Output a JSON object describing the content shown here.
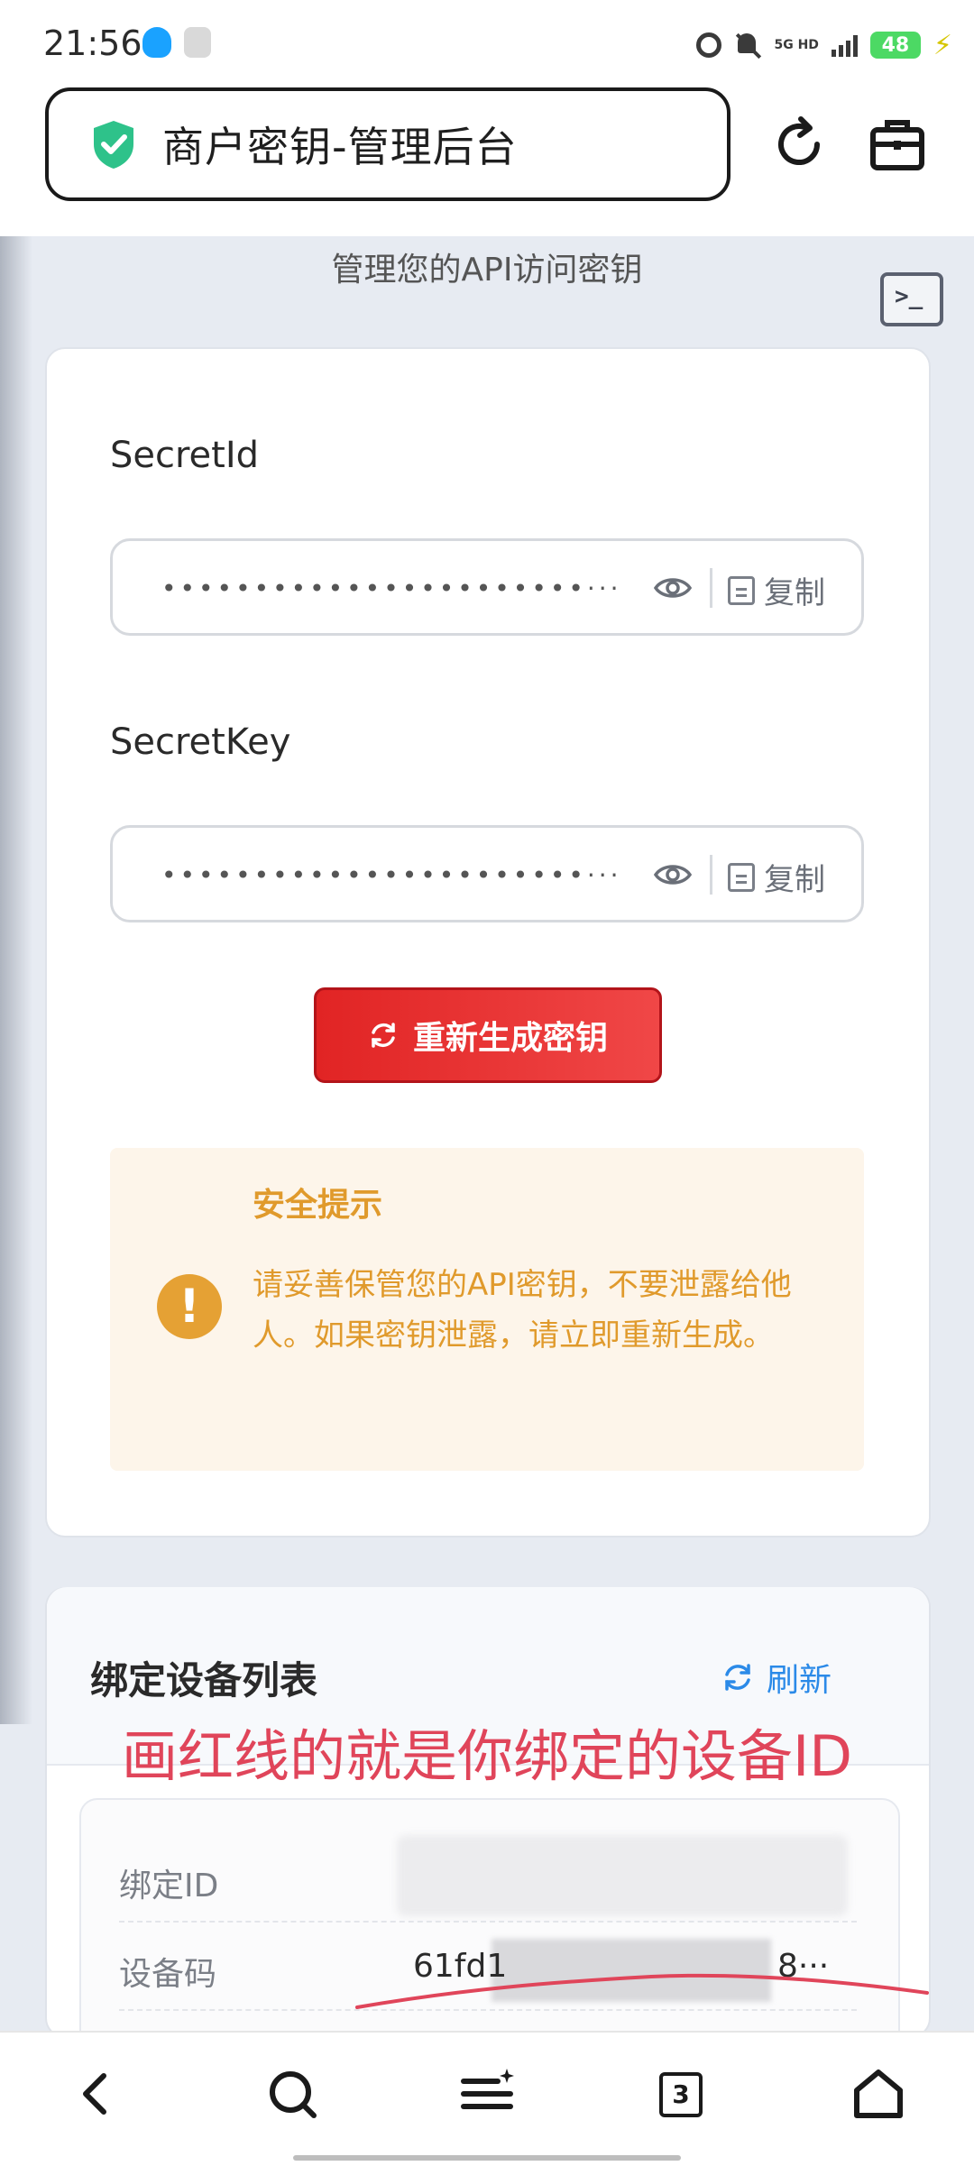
{
  "status_bar": {
    "time": "21:56",
    "network": "5G HD",
    "battery": "48"
  },
  "address_bar": {
    "title": "商户密钥-管理后台"
  },
  "page": {
    "subtitle": "管理您的API访问密钥",
    "secret_id": {
      "label": "SecretId",
      "value": "•••••••••••••••••••••••···",
      "copy_label": "复制"
    },
    "secret_key": {
      "label": "SecretKey",
      "value": "•••••••••••••••••••••••···",
      "copy_label": "复制"
    },
    "regenerate_label": "重新生成密钥",
    "warning": {
      "title": "安全提示",
      "text": "请妥善保管您的API密钥，不要泄露给他人。如果密钥泄露，请立即重新生成。"
    },
    "devices": {
      "title": "绑定设备列表",
      "refresh_label": "刷新",
      "annotation": "画红线的就是你绑定的设备ID",
      "rows": [
        {
          "label": "绑定ID",
          "value": ""
        },
        {
          "label": "设备码",
          "value_start": "61fd1",
          "value_end": "8···"
        }
      ]
    }
  },
  "bottom_bar": {
    "tab_count": "3"
  },
  "colors": {
    "danger": "#e12424",
    "warning": "#e09a2c",
    "link": "#2b8ae8",
    "annotation": "#e0455a"
  }
}
